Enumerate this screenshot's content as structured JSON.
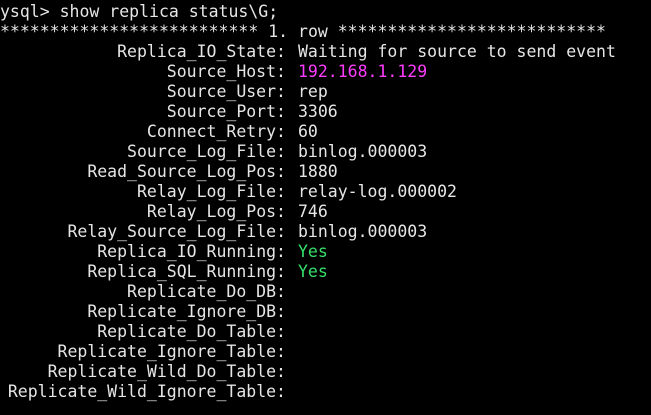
{
  "terminal": {
    "command_line": "ysql> show replica status\\G;",
    "row_separator": "************************** 1. row ***************************",
    "colors": {
      "background": "#000000",
      "text": "#e6e6e6",
      "host_value": "#ff3cff",
      "yes_value": "#37e06a"
    },
    "fields": [
      {
        "key": "Replica_IO_State:",
        "value": "Waiting for source to send event"
      },
      {
        "key": "Source_Host:",
        "value": "192.168.1.129"
      },
      {
        "key": "Source_User:",
        "value": "rep"
      },
      {
        "key": "Source_Port:",
        "value": "3306"
      },
      {
        "key": "Connect_Retry:",
        "value": "60"
      },
      {
        "key": "Source_Log_File:",
        "value": "binlog.000003"
      },
      {
        "key": "Read_Source_Log_Pos:",
        "value": "1880"
      },
      {
        "key": "Relay_Log_File:",
        "value": "relay-log.000002"
      },
      {
        "key": "Relay_Log_Pos:",
        "value": "746"
      },
      {
        "key": "Relay_Source_Log_File:",
        "value": "binlog.000003"
      },
      {
        "key": "Replica_IO_Running:",
        "value": "Yes"
      },
      {
        "key": "Replica_SQL_Running:",
        "value": "Yes"
      },
      {
        "key": "Replicate_Do_DB:",
        "value": ""
      },
      {
        "key": "Replicate_Ignore_DB:",
        "value": ""
      },
      {
        "key": "Replicate_Do_Table:",
        "value": ""
      },
      {
        "key": "Replicate_Ignore_Table:",
        "value": ""
      },
      {
        "key": "Replicate_Wild_Do_Table:",
        "value": ""
      },
      {
        "key": "Replicate_Wild_Ignore_Table:",
        "value": ""
      }
    ]
  }
}
